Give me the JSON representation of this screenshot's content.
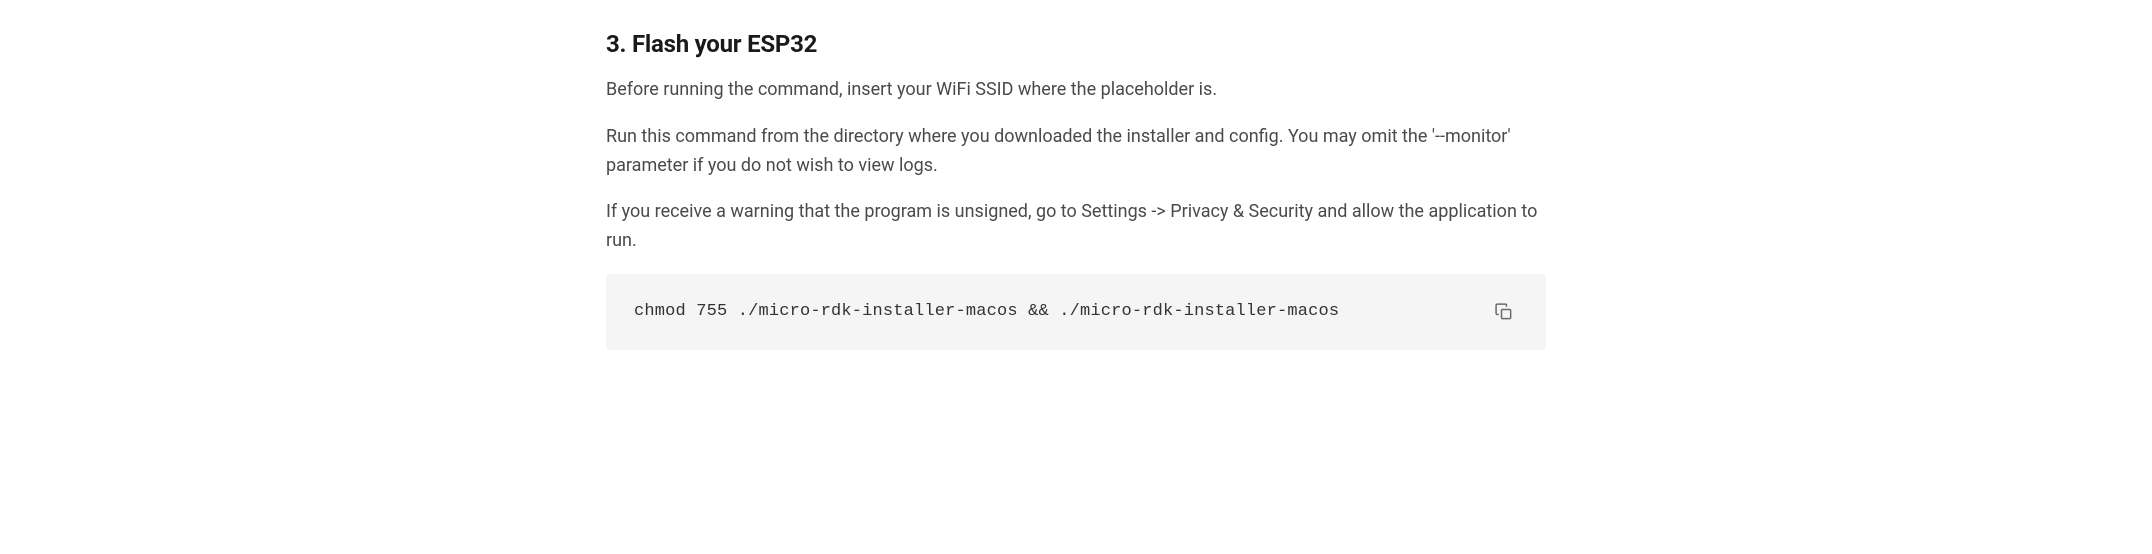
{
  "section": {
    "heading": "3. Flash your ESP32",
    "paragraphs": [
      "Before running the command, insert your WiFi SSID where the placeholder is.",
      "Run this command from the directory where you downloaded the installer and config. You may omit the '--monitor' parameter if you do not wish to view logs.",
      "If you receive a warning that the program is unsigned, go to Settings -> Privacy & Security and allow the application to run."
    ],
    "code": "chmod 755 ./micro-rdk-installer-macos && ./micro-rdk-installer-macos"
  }
}
